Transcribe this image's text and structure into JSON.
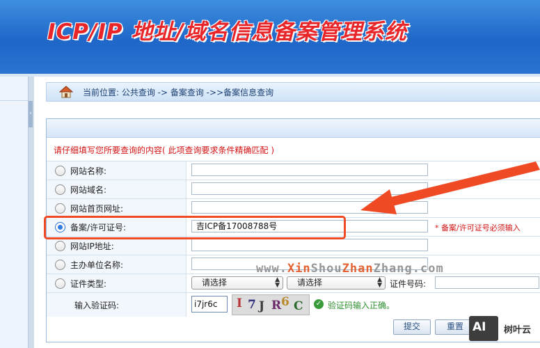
{
  "header": {
    "title": "ICP/IP 地址/域名信息备案管理系统"
  },
  "breadcrumb": {
    "text": "当前位置: 公共查询  ->  备案查询  ->>备案信息查询"
  },
  "form": {
    "notice": "请仔细填写您所要查询的内容( 此项查询要求条件精确匹配 )",
    "rows": [
      {
        "label": "网站名称:",
        "value": "",
        "selected": false
      },
      {
        "label": "网站域名:",
        "value": "",
        "selected": false
      },
      {
        "label": "网站首页网址:",
        "value": "",
        "selected": false
      },
      {
        "label": "备案/许可证号:",
        "value": "吉ICP备17008788号",
        "selected": true,
        "hint": "* 备案/许可证号必须输入"
      },
      {
        "label": "网站IP地址:",
        "value": "",
        "selected": false
      },
      {
        "label": "主办单位名称:",
        "value": "",
        "selected": false
      },
      {
        "label": "证件类型:",
        "selected": false,
        "select1": "请选择",
        "select2": "请选择",
        "cert_label": "证件号码:"
      }
    ],
    "captcha": {
      "label": "输入验证码:",
      "value": "i7jr6c",
      "image_chars": [
        "I",
        "7",
        "J",
        "R",
        "6",
        "C"
      ],
      "status": "验证码输入正确。"
    },
    "buttons": {
      "submit": "提交",
      "reset": "重置"
    }
  },
  "watermark": {
    "prefix": "www.",
    "part1": "Xin",
    "part2": "Shou",
    "part3": "Zhan",
    "part4": "Zhang",
    "suffix": ".com"
  },
  "badge": {
    "logo": "AI",
    "name": "树叶云"
  },
  "colors": {
    "banner": "#1f67c8",
    "title": "#e8262a",
    "required": "#d21414",
    "annotation": "#f04a24",
    "success": "#2f8f2f"
  },
  "icons": [
    "home-icon",
    "check-circle-icon",
    "select-arrow-icon"
  ]
}
